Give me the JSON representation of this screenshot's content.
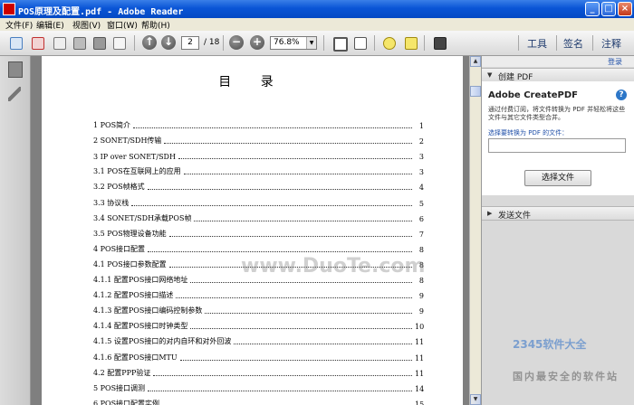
{
  "window": {
    "title": "POS原理及配置.pdf - Adobe Reader"
  },
  "menu": [
    "文件(F)",
    "编辑(E)",
    "视图(V)",
    "窗口(W)",
    "帮助(H)"
  ],
  "toolbar": {
    "page_current": "2",
    "page_total": "/ 18",
    "zoom": "76.8%",
    "tools_label": "工具",
    "sign_label": "签名",
    "comment_label": "注释"
  },
  "document": {
    "heading": "目 录",
    "toc": [
      {
        "title": "1  POS简介",
        "page": "1"
      },
      {
        "title": "2  SONET/SDH传输",
        "page": "2"
      },
      {
        "title": "3  IP over SONET/SDH",
        "page": "3"
      },
      {
        "title": "3.1  POS在互联网上的应用",
        "page": "3"
      },
      {
        "title": "3.2  POS帧格式",
        "page": "4"
      },
      {
        "title": "3.3  协议栈",
        "page": "5"
      },
      {
        "title": "3.4  SONET/SDH承载POS帧",
        "page": "6"
      },
      {
        "title": "3.5  POS物理设备功能",
        "page": "7"
      },
      {
        "title": "4  POS接口配置",
        "page": "8"
      },
      {
        "title": "4.1  POS接口参数配置",
        "page": "8"
      },
      {
        "title": "4.1.1  配置POS接口网络地址",
        "page": "8"
      },
      {
        "title": "4.1.2  配置POS接口描述",
        "page": "9"
      },
      {
        "title": "4.1.3  配置POS接口编码控制参数",
        "page": "9"
      },
      {
        "title": "4.1.4  配置POS接口时钟类型",
        "page": "10"
      },
      {
        "title": "4.1.5  设置POS接口的对内自环和对外回波",
        "page": "11"
      },
      {
        "title": "4.1.6  配置POS接口MTU",
        "page": "11"
      },
      {
        "title": "4.2  配置PPP验证",
        "page": "11"
      },
      {
        "title": "5  POS接口调测",
        "page": "14"
      },
      {
        "title": "6  POS接口配置实例",
        "page": "15"
      }
    ],
    "watermark": "www.DuoTe.com"
  },
  "panel": {
    "login": "登录",
    "create_pdf_section": "创建 PDF",
    "create_pdf_title": "Adobe CreatePDF",
    "create_pdf_desc": "通过付费订阅，将文件转换为 PDF 并轻松将这些文件与其它文件类型合并。",
    "select_label": "选择要转换为 PDF 的文件：",
    "select_button": "选择文件",
    "send_section": "发送文件"
  },
  "branding": {
    "logo": "2345软件大全",
    "slogan": "国内最安全的软件站"
  }
}
